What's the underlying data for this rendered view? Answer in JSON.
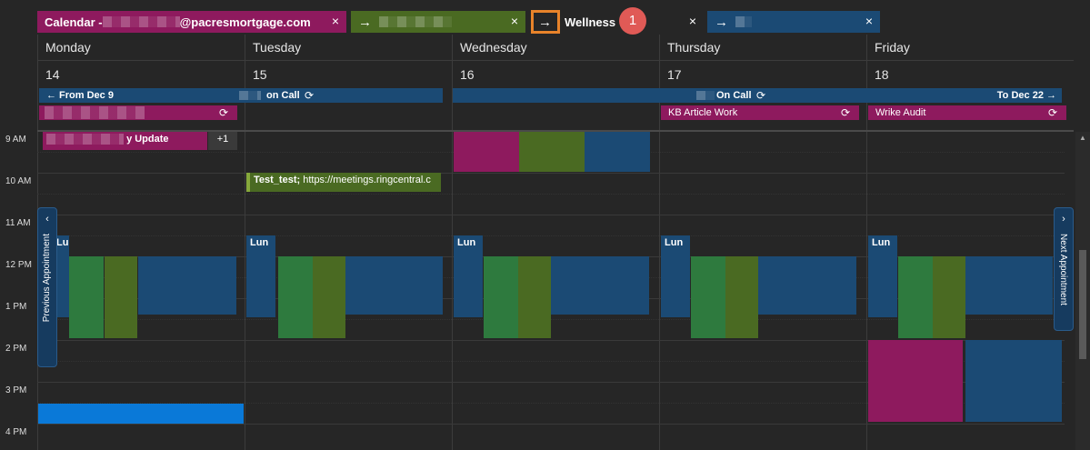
{
  "tabs": [
    {
      "label": "Calendar - ",
      "suffix": "@pacresmortgage.com",
      "close": "×"
    },
    {
      "label": "",
      "close": "×"
    },
    {
      "label": "Wellness",
      "close": "×",
      "badge": "1"
    },
    {
      "label": "",
      "close": "×"
    }
  ],
  "days": [
    {
      "name": "Monday",
      "date": "14"
    },
    {
      "name": "Tuesday",
      "date": "15"
    },
    {
      "name": "Wednesday",
      "date": "16"
    },
    {
      "name": "Thursday",
      "date": "17"
    },
    {
      "name": "Friday",
      "date": "18"
    }
  ],
  "allday": {
    "from": "← From Dec 9",
    "oncall1": "on Call",
    "oncall2": "On Call",
    "to": "To Dec 22 →",
    "kb": "KB Article Work",
    "wrike": "Wrike Audit"
  },
  "times": [
    "9 AM",
    "10 AM",
    "11 AM",
    "12 PM",
    "1 PM",
    "2 PM",
    "3 PM",
    "4 PM"
  ],
  "events": {
    "mon_update": "y Update",
    "mon_more": "+1",
    "tue_test_bold": "Test_test;",
    "tue_test_rest": " https://meetings.ringcentral.c",
    "lunch": "Lun"
  },
  "nav": {
    "prev": "Previous Appointment",
    "next": "Next Appointment"
  },
  "colors": {
    "pink": "#8e1a5e",
    "blue": "#1b4a74",
    "green": "#2e7a3e",
    "olive": "#4a6a22",
    "highlight": "#e8832a"
  }
}
